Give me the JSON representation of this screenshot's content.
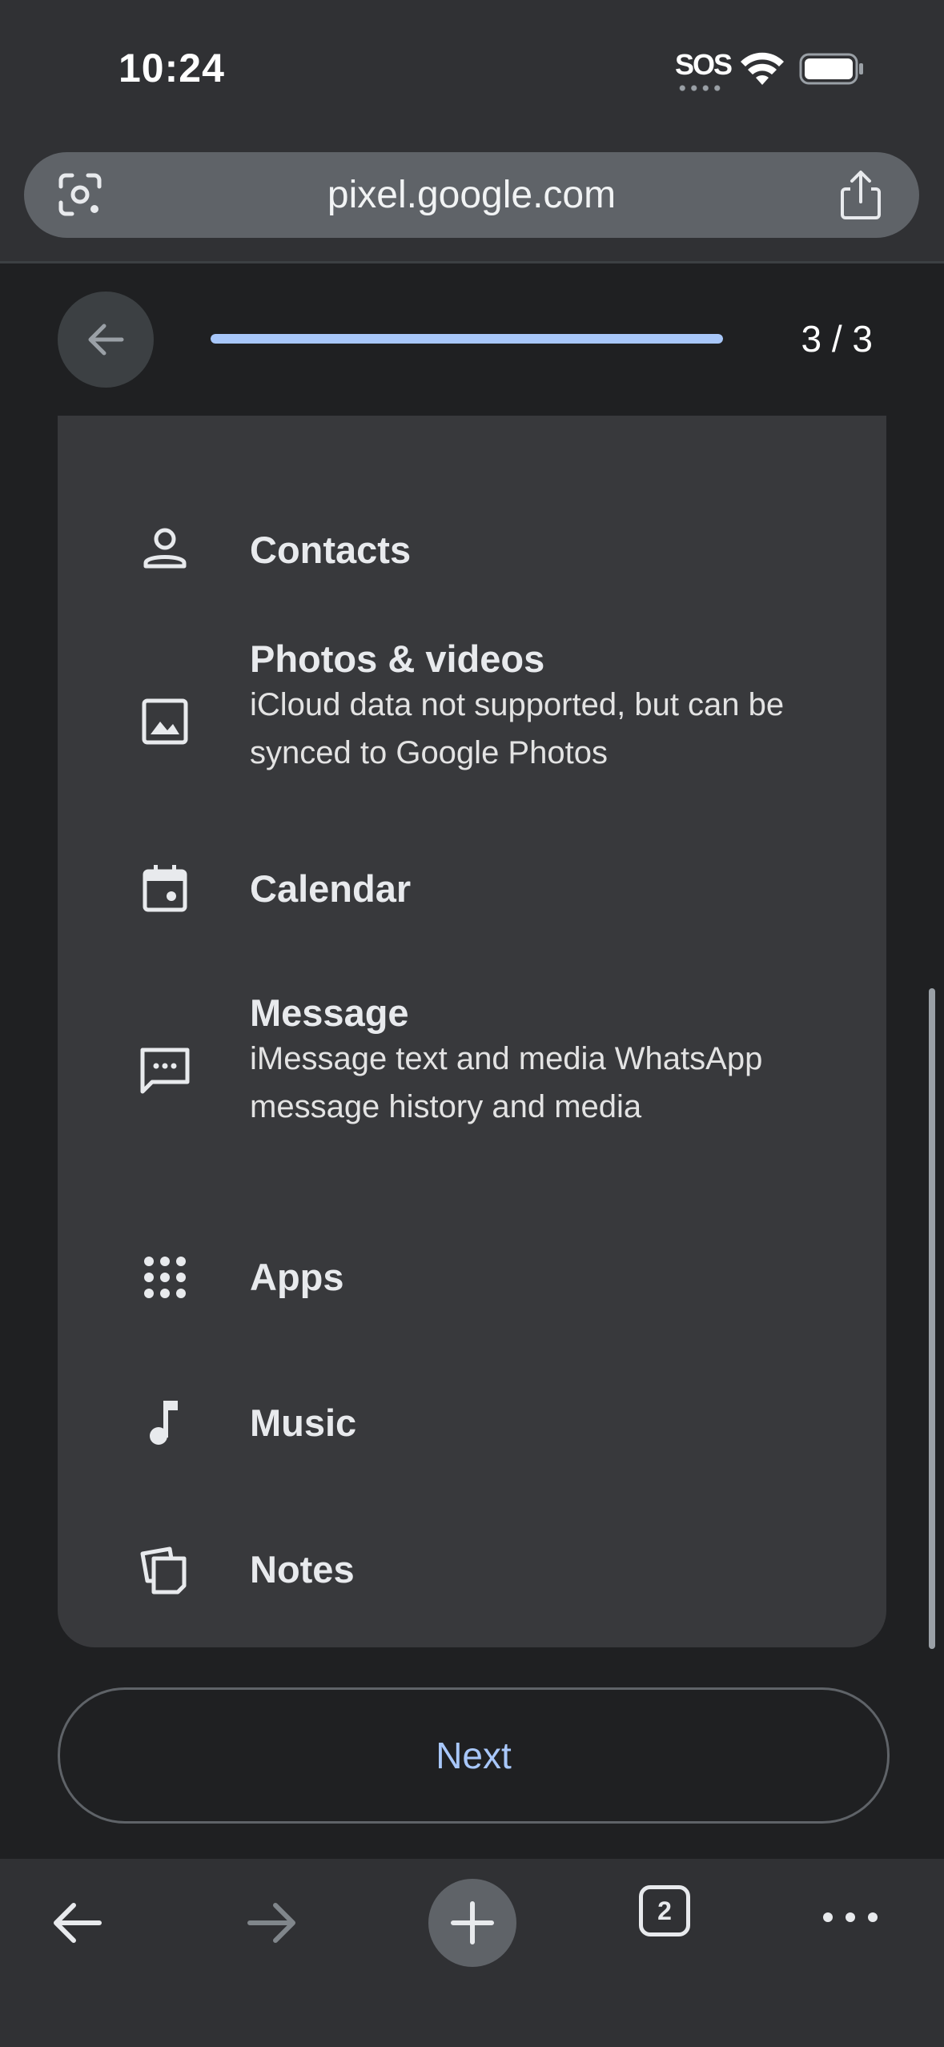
{
  "status_bar": {
    "time": "10:24",
    "sos": "SOS",
    "icons": [
      "wifi-icon",
      "battery-icon"
    ]
  },
  "browser": {
    "url": "pixel.google.com",
    "icons": [
      "lens-icon",
      "share-icon"
    ]
  },
  "header": {
    "step_label": "3 / 3",
    "progress_fraction": 1.0
  },
  "items": [
    {
      "title": "Contacts",
      "icon": "contacts-icon"
    },
    {
      "title": "Photos & videos",
      "icon": "photo-icon",
      "desc": "iCloud data not supported, but can be synced to Google Photos"
    },
    {
      "title": "Calendar",
      "icon": "calendar-icon"
    },
    {
      "title": "Message",
      "icon": "message-icon",
      "desc": "iMessage text and media WhatsApp message history and media"
    },
    {
      "title": "Apps",
      "icon": "apps-icon"
    },
    {
      "title": "Music",
      "icon": "music-icon"
    },
    {
      "title": "Notes",
      "icon": "notes-icon"
    }
  ],
  "next_button": "Next",
  "toolbar": {
    "tab_count": "2",
    "icons": [
      "back-icon",
      "forward-icon",
      "new-tab-icon",
      "tabs-icon",
      "more-icon"
    ]
  },
  "colors": {
    "accent": "#a8c7fa",
    "card": "#38393c",
    "background": "#1f2022"
  }
}
